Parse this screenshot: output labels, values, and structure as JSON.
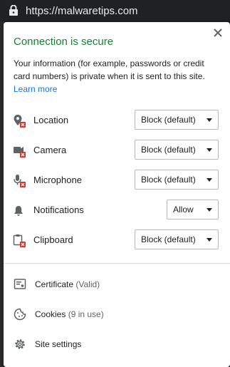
{
  "address_bar": {
    "url": "https://malwaretips.com"
  },
  "popup": {
    "title": "Connection is secure",
    "description": "Your information (for example, passwords or credit card numbers) is private when it is sent to this site.",
    "learn_more": "Learn more",
    "permissions": [
      {
        "label": "Location",
        "value": "Block (default)"
      },
      {
        "label": "Camera",
        "value": "Block (default)"
      },
      {
        "label": "Microphone",
        "value": "Block (default)"
      },
      {
        "label": "Notifications",
        "value": "Allow"
      },
      {
        "label": "Clipboard",
        "value": "Block (default)"
      }
    ],
    "certificate": {
      "label": "Certificate",
      "status": "(Valid)"
    },
    "cookies": {
      "label": "Cookies",
      "count": "(9 in use)"
    },
    "site_settings": {
      "label": "Site settings"
    }
  },
  "colors": {
    "secure_green": "#188038",
    "link_blue": "#1a73e8",
    "blocked_red": "#d93025"
  }
}
